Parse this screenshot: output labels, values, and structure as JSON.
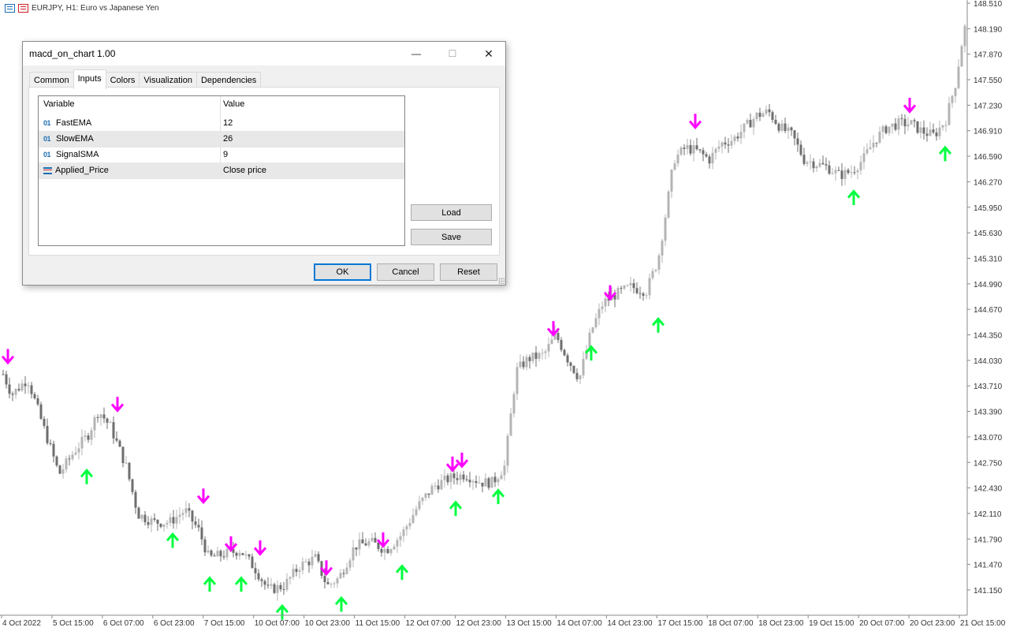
{
  "window": {
    "title": "EURJPY, H1:  Euro vs Japanese Yen"
  },
  "chart_data": {
    "type": "candlestick",
    "symbol": "EURJPY",
    "timeframe": "H1",
    "price_axis": {
      "ticks": [
        "148.510",
        "148.190",
        "147.870",
        "147.550",
        "147.230",
        "146.910",
        "146.590",
        "146.270",
        "145.950",
        "145.630",
        "145.310",
        "144.990",
        "144.670",
        "144.350",
        "144.030",
        "143.710",
        "143.390",
        "143.070",
        "142.750",
        "142.430",
        "142.110",
        "141.790",
        "141.470",
        "141.150"
      ],
      "range": [
        140.95,
        148.55
      ]
    },
    "time_axis": {
      "labels": [
        "4 Oct 2022",
        "5 Oct 15:00",
        "6 Oct 07:00",
        "6 Oct 23:00",
        "7 Oct 15:00",
        "10 Oct 07:00",
        "10 Oct 23:00",
        "11 Oct 15:00",
        "12 Oct 07:00",
        "12 Oct 23:00",
        "13 Oct 15:00",
        "14 Oct 07:00",
        "14 Oct 23:00",
        "17 Oct 15:00",
        "18 Oct 07:00",
        "18 Oct 23:00",
        "19 Oct 15:00",
        "20 Oct 07:00",
        "20 Oct 23:00",
        "21 Oct 15:00"
      ]
    },
    "price_path": [
      [
        0,
        143.95
      ],
      [
        15,
        143.6
      ],
      [
        35,
        143.8
      ],
      [
        55,
        143.2
      ],
      [
        75,
        142.6
      ],
      [
        95,
        142.9
      ],
      [
        112,
        143.1
      ],
      [
        125,
        143.4
      ],
      [
        140,
        143.2
      ],
      [
        160,
        142.7
      ],
      [
        175,
        142.1
      ],
      [
        195,
        142.0
      ],
      [
        215,
        142.0
      ],
      [
        235,
        142.15
      ],
      [
        252,
        141.9
      ],
      [
        265,
        141.55
      ],
      [
        285,
        141.6
      ],
      [
        305,
        141.65
      ],
      [
        325,
        141.4
      ],
      [
        340,
        141.15
      ],
      [
        360,
        141.2
      ],
      [
        380,
        141.45
      ],
      [
        400,
        141.55
      ],
      [
        415,
        141.2
      ],
      [
        430,
        141.3
      ],
      [
        450,
        141.7
      ],
      [
        470,
        141.75
      ],
      [
        490,
        141.65
      ],
      [
        510,
        141.85
      ],
      [
        530,
        142.2
      ],
      [
        550,
        142.45
      ],
      [
        570,
        142.55
      ],
      [
        590,
        142.6
      ],
      [
        610,
        142.5
      ],
      [
        625,
        142.5
      ],
      [
        640,
        142.7
      ],
      [
        655,
        143.9
      ],
      [
        670,
        144.05
      ],
      [
        690,
        144.1
      ],
      [
        705,
        144.35
      ],
      [
        720,
        144.05
      ],
      [
        735,
        143.8
      ],
      [
        750,
        144.4
      ],
      [
        765,
        144.75
      ],
      [
        780,
        144.85
      ],
      [
        800,
        144.95
      ],
      [
        820,
        144.9
      ],
      [
        835,
        145.3
      ],
      [
        845,
        145.9
      ],
      [
        855,
        146.55
      ],
      [
        870,
        146.7
      ],
      [
        885,
        146.65
      ],
      [
        900,
        146.55
      ],
      [
        915,
        146.75
      ],
      [
        930,
        146.8
      ],
      [
        945,
        146.95
      ],
      [
        960,
        147.1
      ],
      [
        975,
        147.15
      ],
      [
        990,
        146.95
      ],
      [
        1005,
        146.85
      ],
      [
        1020,
        146.55
      ],
      [
        1035,
        146.5
      ],
      [
        1050,
        146.45
      ],
      [
        1065,
        146.35
      ],
      [
        1080,
        146.4
      ],
      [
        1095,
        146.55
      ],
      [
        1110,
        146.8
      ],
      [
        1125,
        146.95
      ],
      [
        1140,
        147.0
      ],
      [
        1155,
        147.0
      ],
      [
        1170,
        146.9
      ],
      [
        1185,
        146.85
      ],
      [
        1200,
        147.05
      ],
      [
        1212,
        147.5
      ],
      [
        1220,
        148.0
      ],
      [
        1226,
        148.3
      ]
    ],
    "signals": {
      "down_color": "#ff00ff",
      "up_color": "#00ff3f",
      "down": [
        [
          10,
          143.95
        ],
        [
          149,
          143.35
        ],
        [
          258,
          142.2
        ],
        [
          293,
          141.6
        ],
        [
          330,
          141.55
        ],
        [
          414,
          141.3
        ],
        [
          486,
          141.65
        ],
        [
          574,
          142.6
        ],
        [
          586,
          142.65
        ],
        [
          702,
          144.3
        ],
        [
          774,
          144.75
        ],
        [
          882,
          146.9
        ],
        [
          1154,
          147.1
        ]
      ],
      "up": [
        [
          110,
          142.7
        ],
        [
          219,
          141.9
        ],
        [
          266,
          141.35
        ],
        [
          306,
          141.35
        ],
        [
          358,
          141.0
        ],
        [
          433,
          141.1
        ],
        [
          510,
          141.5
        ],
        [
          578,
          142.3
        ],
        [
          632,
          142.45
        ],
        [
          750,
          144.25
        ],
        [
          835,
          144.6
        ],
        [
          1083,
          146.2
        ],
        [
          1199,
          146.75
        ]
      ]
    }
  },
  "dialog": {
    "title": "macd_on_chart 1.00",
    "tabs": [
      "Common",
      "Inputs",
      "Colors",
      "Visualization",
      "Dependencies"
    ],
    "active_tab": "Inputs",
    "grid": {
      "headers": [
        "Variable",
        "Value"
      ],
      "rows": [
        {
          "type_icon": "01",
          "name": "FastEMA",
          "value": "12"
        },
        {
          "type_icon": "01",
          "name": "SlowEMA",
          "value": "26"
        },
        {
          "type_icon": "01",
          "name": "SignalSMA",
          "value": "9"
        },
        {
          "type_icon": "enum",
          "name": "Applied_Price",
          "value": "Close price"
        }
      ]
    },
    "side_buttons": {
      "load": "Load",
      "save": "Save"
    },
    "footer_buttons": {
      "ok": "OK",
      "cancel": "Cancel",
      "reset": "Reset"
    },
    "window_buttons": {
      "minimize": "—",
      "maximize": "☐",
      "close": "✕"
    }
  }
}
